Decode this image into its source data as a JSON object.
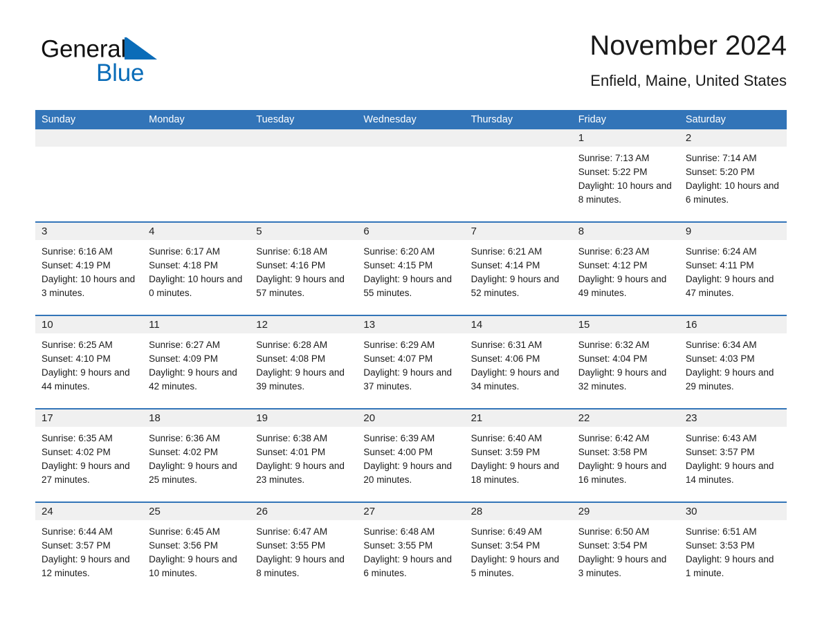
{
  "brand": {
    "name_dark": "General",
    "name_light": "Blue",
    "triangle_color": "#0a6cb8",
    "icon": "triangle-logo-icon"
  },
  "header": {
    "title": "November 2024",
    "location": "Enfield, Maine, United States"
  },
  "colors": {
    "header_blue": "#3274b8",
    "day_strip_gray": "#f0f0f0",
    "brand_blue": "#0a6cb8",
    "text": "#1a1a1a"
  },
  "weekdays": [
    "Sunday",
    "Monday",
    "Tuesday",
    "Wednesday",
    "Thursday",
    "Friday",
    "Saturday"
  ],
  "weeks": [
    [
      {
        "day": "",
        "sunrise": "",
        "sunset": "",
        "daylight": ""
      },
      {
        "day": "",
        "sunrise": "",
        "sunset": "",
        "daylight": ""
      },
      {
        "day": "",
        "sunrise": "",
        "sunset": "",
        "daylight": ""
      },
      {
        "day": "",
        "sunrise": "",
        "sunset": "",
        "daylight": ""
      },
      {
        "day": "",
        "sunrise": "",
        "sunset": "",
        "daylight": ""
      },
      {
        "day": "1",
        "sunrise": "Sunrise: 7:13 AM",
        "sunset": "Sunset: 5:22 PM",
        "daylight": "Daylight: 10 hours and 8 minutes."
      },
      {
        "day": "2",
        "sunrise": "Sunrise: 7:14 AM",
        "sunset": "Sunset: 5:20 PM",
        "daylight": "Daylight: 10 hours and 6 minutes."
      }
    ],
    [
      {
        "day": "3",
        "sunrise": "Sunrise: 6:16 AM",
        "sunset": "Sunset: 4:19 PM",
        "daylight": "Daylight: 10 hours and 3 minutes."
      },
      {
        "day": "4",
        "sunrise": "Sunrise: 6:17 AM",
        "sunset": "Sunset: 4:18 PM",
        "daylight": "Daylight: 10 hours and 0 minutes."
      },
      {
        "day": "5",
        "sunrise": "Sunrise: 6:18 AM",
        "sunset": "Sunset: 4:16 PM",
        "daylight": "Daylight: 9 hours and 57 minutes."
      },
      {
        "day": "6",
        "sunrise": "Sunrise: 6:20 AM",
        "sunset": "Sunset: 4:15 PM",
        "daylight": "Daylight: 9 hours and 55 minutes."
      },
      {
        "day": "7",
        "sunrise": "Sunrise: 6:21 AM",
        "sunset": "Sunset: 4:14 PM",
        "daylight": "Daylight: 9 hours and 52 minutes."
      },
      {
        "day": "8",
        "sunrise": "Sunrise: 6:23 AM",
        "sunset": "Sunset: 4:12 PM",
        "daylight": "Daylight: 9 hours and 49 minutes."
      },
      {
        "day": "9",
        "sunrise": "Sunrise: 6:24 AM",
        "sunset": "Sunset: 4:11 PM",
        "daylight": "Daylight: 9 hours and 47 minutes."
      }
    ],
    [
      {
        "day": "10",
        "sunrise": "Sunrise: 6:25 AM",
        "sunset": "Sunset: 4:10 PM",
        "daylight": "Daylight: 9 hours and 44 minutes."
      },
      {
        "day": "11",
        "sunrise": "Sunrise: 6:27 AM",
        "sunset": "Sunset: 4:09 PM",
        "daylight": "Daylight: 9 hours and 42 minutes."
      },
      {
        "day": "12",
        "sunrise": "Sunrise: 6:28 AM",
        "sunset": "Sunset: 4:08 PM",
        "daylight": "Daylight: 9 hours and 39 minutes."
      },
      {
        "day": "13",
        "sunrise": "Sunrise: 6:29 AM",
        "sunset": "Sunset: 4:07 PM",
        "daylight": "Daylight: 9 hours and 37 minutes."
      },
      {
        "day": "14",
        "sunrise": "Sunrise: 6:31 AM",
        "sunset": "Sunset: 4:06 PM",
        "daylight": "Daylight: 9 hours and 34 minutes."
      },
      {
        "day": "15",
        "sunrise": "Sunrise: 6:32 AM",
        "sunset": "Sunset: 4:04 PM",
        "daylight": "Daylight: 9 hours and 32 minutes."
      },
      {
        "day": "16",
        "sunrise": "Sunrise: 6:34 AM",
        "sunset": "Sunset: 4:03 PM",
        "daylight": "Daylight: 9 hours and 29 minutes."
      }
    ],
    [
      {
        "day": "17",
        "sunrise": "Sunrise: 6:35 AM",
        "sunset": "Sunset: 4:02 PM",
        "daylight": "Daylight: 9 hours and 27 minutes."
      },
      {
        "day": "18",
        "sunrise": "Sunrise: 6:36 AM",
        "sunset": "Sunset: 4:02 PM",
        "daylight": "Daylight: 9 hours and 25 minutes."
      },
      {
        "day": "19",
        "sunrise": "Sunrise: 6:38 AM",
        "sunset": "Sunset: 4:01 PM",
        "daylight": "Daylight: 9 hours and 23 minutes."
      },
      {
        "day": "20",
        "sunrise": "Sunrise: 6:39 AM",
        "sunset": "Sunset: 4:00 PM",
        "daylight": "Daylight: 9 hours and 20 minutes."
      },
      {
        "day": "21",
        "sunrise": "Sunrise: 6:40 AM",
        "sunset": "Sunset: 3:59 PM",
        "daylight": "Daylight: 9 hours and 18 minutes."
      },
      {
        "day": "22",
        "sunrise": "Sunrise: 6:42 AM",
        "sunset": "Sunset: 3:58 PM",
        "daylight": "Daylight: 9 hours and 16 minutes."
      },
      {
        "day": "23",
        "sunrise": "Sunrise: 6:43 AM",
        "sunset": "Sunset: 3:57 PM",
        "daylight": "Daylight: 9 hours and 14 minutes."
      }
    ],
    [
      {
        "day": "24",
        "sunrise": "Sunrise: 6:44 AM",
        "sunset": "Sunset: 3:57 PM",
        "daylight": "Daylight: 9 hours and 12 minutes."
      },
      {
        "day": "25",
        "sunrise": "Sunrise: 6:45 AM",
        "sunset": "Sunset: 3:56 PM",
        "daylight": "Daylight: 9 hours and 10 minutes."
      },
      {
        "day": "26",
        "sunrise": "Sunrise: 6:47 AM",
        "sunset": "Sunset: 3:55 PM",
        "daylight": "Daylight: 9 hours and 8 minutes."
      },
      {
        "day": "27",
        "sunrise": "Sunrise: 6:48 AM",
        "sunset": "Sunset: 3:55 PM",
        "daylight": "Daylight: 9 hours and 6 minutes."
      },
      {
        "day": "28",
        "sunrise": "Sunrise: 6:49 AM",
        "sunset": "Sunset: 3:54 PM",
        "daylight": "Daylight: 9 hours and 5 minutes."
      },
      {
        "day": "29",
        "sunrise": "Sunrise: 6:50 AM",
        "sunset": "Sunset: 3:54 PM",
        "daylight": "Daylight: 9 hours and 3 minutes."
      },
      {
        "day": "30",
        "sunrise": "Sunrise: 6:51 AM",
        "sunset": "Sunset: 3:53 PM",
        "daylight": "Daylight: 9 hours and 1 minute."
      }
    ]
  ]
}
